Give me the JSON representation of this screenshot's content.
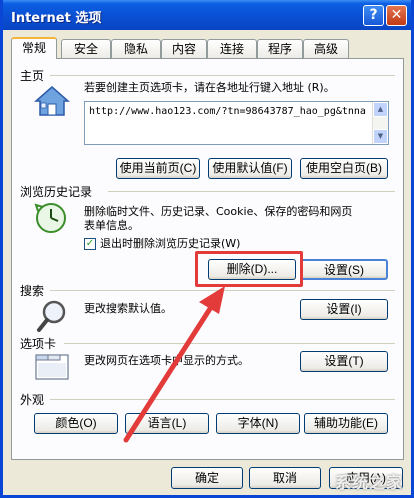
{
  "window": {
    "title": "Internet 选项"
  },
  "tabs": [
    "常规",
    "安全",
    "隐私",
    "内容",
    "连接",
    "程序",
    "高级"
  ],
  "home": {
    "section": "主页",
    "desc": "若要创建主页选项卡，请在各地址行键入地址 (R)。",
    "url": "http://www.hao123.com/?tn=98643787_hao_pg&tnna",
    "btn_current": "使用当前页(C)",
    "btn_default": "使用默认值(F)",
    "btn_blank": "使用空白页(B)"
  },
  "history": {
    "section": "浏览历史记录",
    "desc1": "删除临时文件、历史记录、Cookie、保存的密码和网页",
    "desc2": "表单信息。",
    "checkbox": "退出时删除浏览历史记录(W)",
    "btn_delete": "删除(D)...",
    "btn_settings": "设置(S)"
  },
  "search": {
    "section": "搜索",
    "desc": "更改搜索默认值。",
    "btn_settings": "设置(I)"
  },
  "tabs_section": {
    "section": "选项卡",
    "desc": "更改网页在选项卡中显示的方式。",
    "btn_settings": "设置(T)"
  },
  "appearance": {
    "section": "外观",
    "btn_colors": "颜色(O)",
    "btn_languages": "语言(L)",
    "btn_fonts": "字体(N)",
    "btn_accessibility": "辅助功能(E)"
  },
  "footer": {
    "ok": "确定",
    "cancel": "取消",
    "apply": "应用(A)"
  },
  "watermark": "系统之家",
  "colors": {
    "titlebar": "#0a4fd3",
    "highlight": "#e33a3a",
    "arrow": "#e33a3a"
  }
}
